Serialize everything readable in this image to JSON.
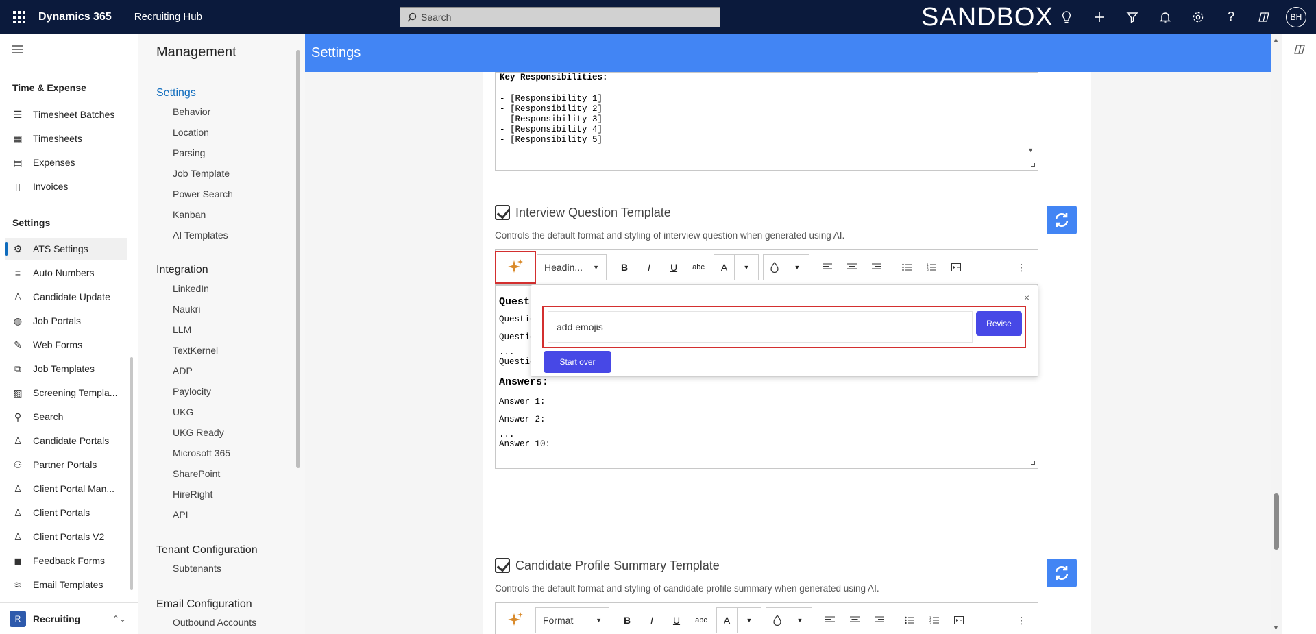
{
  "topbar": {
    "brand": "Dynamics 365",
    "app_name": "Recruiting Hub",
    "search_placeholder": "Search",
    "environment": "SANDBOX",
    "avatar_initials": "BH"
  },
  "leftnav": {
    "group1_title": "Time & Expense",
    "group1_items": [
      "Timesheet Batches",
      "Timesheets",
      "Expenses",
      "Invoices"
    ],
    "group2_title": "Settings",
    "group2_items": [
      "ATS Settings",
      "Auto Numbers",
      "Candidate Update",
      "Job Portals",
      "Web Forms",
      "Job Templates",
      "Screening Templa...",
      "Search",
      "Candidate Portals",
      "Partner Portals",
      "Client Portal Man...",
      "Client Portals",
      "Client Portals V2",
      "Feedback Forms",
      "Email Templates"
    ],
    "area_badge": "R",
    "area_name": "Recruiting"
  },
  "management": {
    "title": "Management",
    "settings_title": "Settings",
    "settings_links": [
      "Behavior",
      "Location",
      "Parsing",
      "Job Template",
      "Power Search",
      "Kanban",
      "AI Templates"
    ],
    "integration_title": "Integration",
    "integration_links": [
      "LinkedIn",
      "Naukri",
      "LLM",
      "TextKernel",
      "ADP",
      "Paylocity",
      "UKG",
      "UKG Ready",
      "Microsoft 365",
      "SharePoint",
      "HireRight",
      "API"
    ],
    "tenant_title": "Tenant Configuration",
    "tenant_links": [
      "Subtenants"
    ],
    "email_title": "Email Configuration",
    "email_links": [
      "Outbound Accounts"
    ]
  },
  "page": {
    "header": "Settings"
  },
  "job_template_preview": {
    "heading": "Key Responsibilities:",
    "lines": [
      "- [Responsibility 1]",
      "- [Responsibility 2]",
      "- [Responsibility 3]",
      "- [Responsibility 4]",
      "- [Responsibility 5]"
    ]
  },
  "interview_section": {
    "title": "Interview Question Template",
    "description": "Controls the default format and styling of interview question when generated using AI.",
    "toolbar_style": "Headin...",
    "editor": {
      "questions_heading": "Quest",
      "question_lines": [
        "Questio",
        "Questio",
        "...",
        "Questio"
      ],
      "answers_heading": "Answers:",
      "answer_lines": [
        "Answer 1:",
        "Answer 2:",
        "...",
        "Answer 10:"
      ]
    },
    "ai_popup": {
      "input_value": "add emojis",
      "revise_label": "Revise",
      "start_over_label": "Start over",
      "close_label": "×"
    }
  },
  "candidate_section": {
    "title": "Candidate Profile Summary Template",
    "description": "Controls the default format and styling of candidate profile summary when generated using AI.",
    "toolbar_style": "Format"
  },
  "toolbar_labels": {
    "bold": "B",
    "italic": "I",
    "underline": "U",
    "strike": "abc",
    "font_color": "A"
  },
  "colors": {
    "topbar": "#0b1a3c",
    "settings_bar": "#4285f4",
    "primary_button": "#4748e6",
    "highlight": "#d32f2f",
    "ai_icon": "#d98a2b"
  }
}
